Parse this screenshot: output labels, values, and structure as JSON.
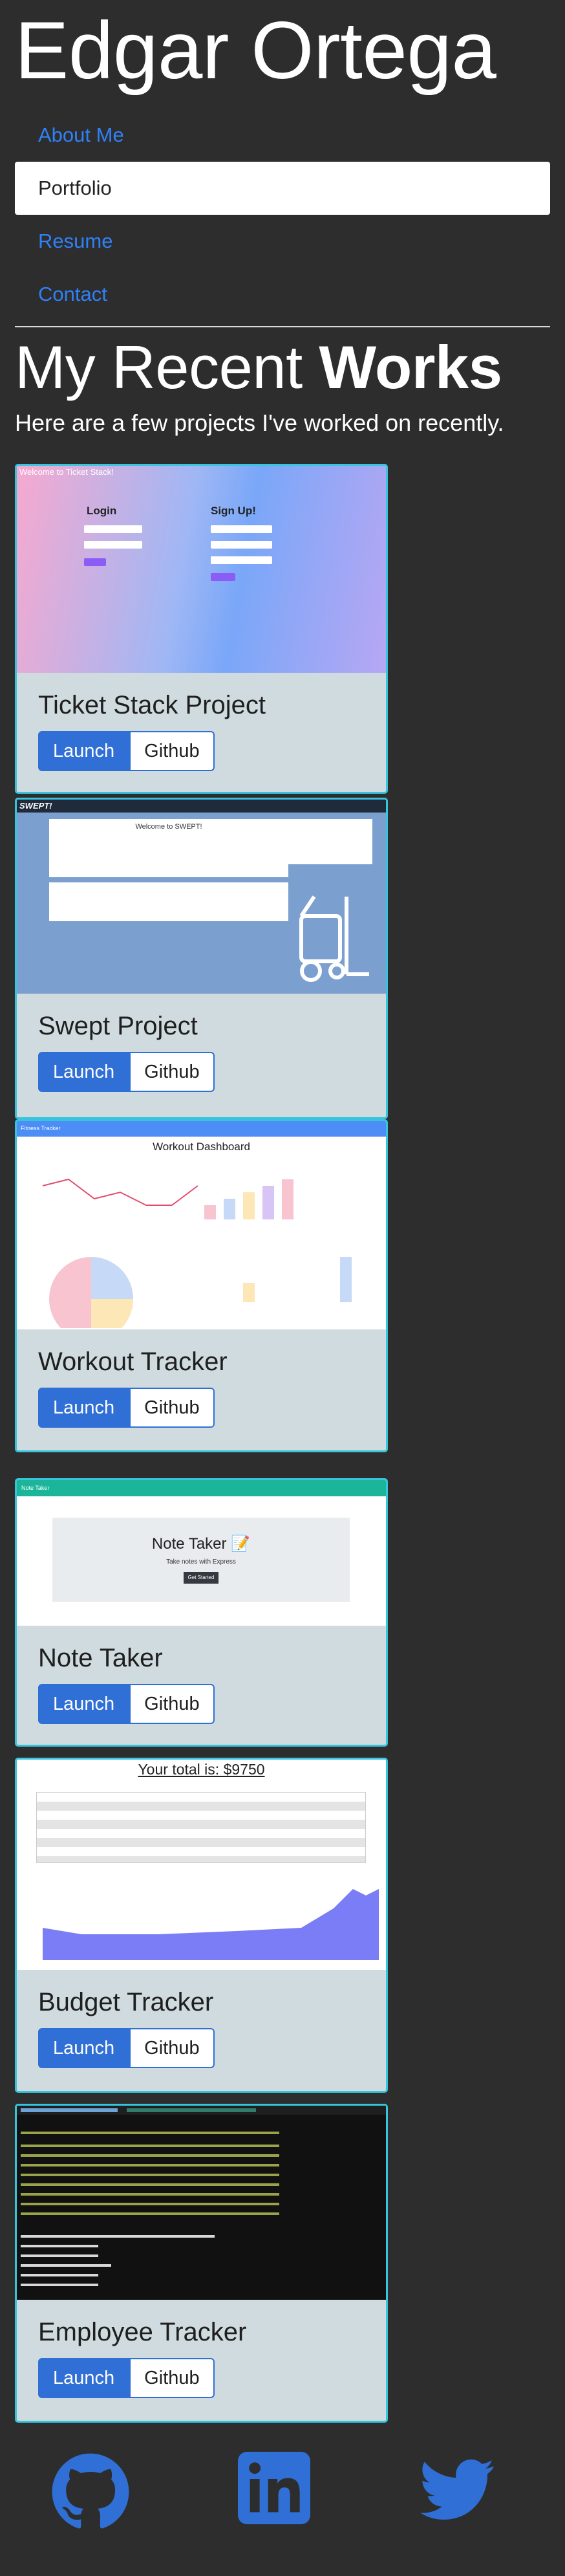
{
  "header": {
    "name": "Edgar Ortega"
  },
  "nav": [
    {
      "label": "About Me"
    },
    {
      "label": "Portfolio"
    },
    {
      "label": "Resume"
    },
    {
      "label": "Contact"
    }
  ],
  "section": {
    "heading_light": "My Recent",
    "heading_bold": "Works",
    "intro": "Here are a few projects I've worked on recently."
  },
  "buttons": {
    "launch": "Launch",
    "github": "Github"
  },
  "projects": [
    {
      "title": "Ticket Stack Project"
    },
    {
      "title": "Swept Project"
    },
    {
      "title": "Workout Tracker"
    },
    {
      "title": "Note Taker"
    },
    {
      "title": "Budget Tracker"
    },
    {
      "title": "Employee Tracker"
    }
  ],
  "screens": {
    "ticket": {
      "banner": "Welcome to Ticket Stack!",
      "login": "Login",
      "signup": "Sign Up!"
    },
    "swept": {
      "logo": "SWEPT!",
      "welcome": "Welcome to SWEPT!"
    },
    "workout": {
      "nav": "Fitness Tracker",
      "title": "Workout Dashboard"
    },
    "note": {
      "nav": "Note Taker",
      "title": "Note Taker 📝",
      "subtitle": "Take notes with Express",
      "button": "Get Started"
    },
    "budget": {
      "total": "Your total is: $9750"
    }
  },
  "footer": {
    "icons": [
      "github-icon",
      "linkedin-icon",
      "twitter-icon"
    ]
  },
  "colors": {
    "background": "#2d2d2d",
    "accent": "#2f6fd6",
    "card_border": "#37c4dd",
    "card_bg": "#cfdbde"
  }
}
